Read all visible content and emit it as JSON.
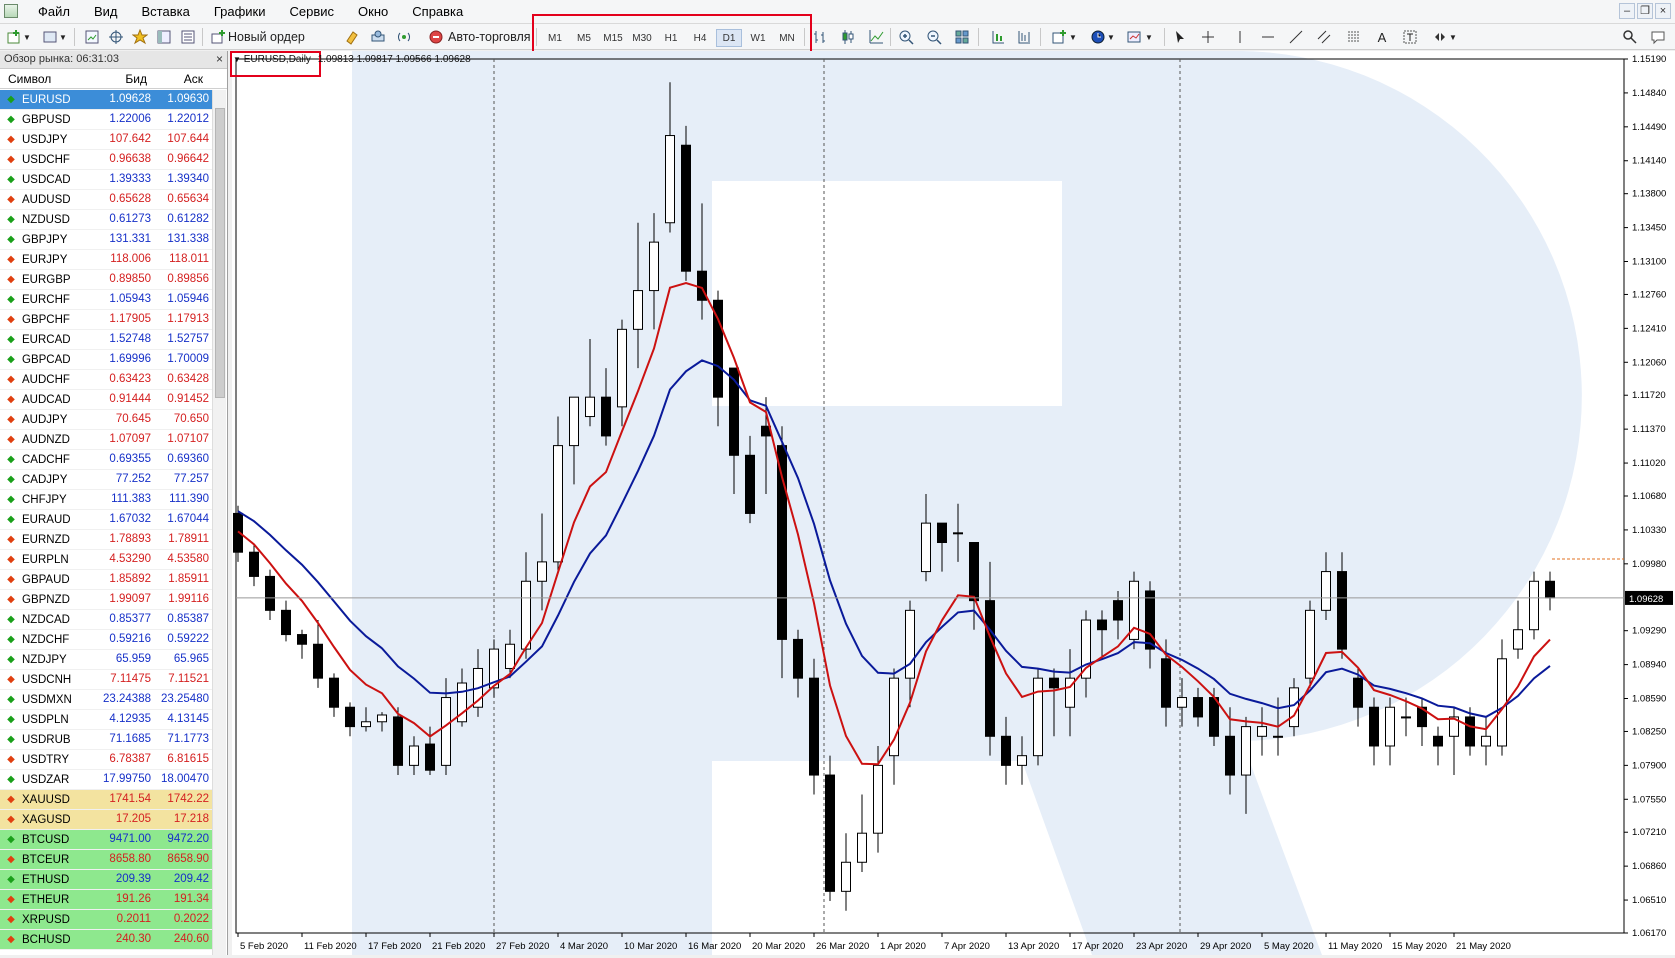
{
  "menu": [
    "Файл",
    "Вид",
    "Вставка",
    "Графики",
    "Сервис",
    "Окно",
    "Справка"
  ],
  "toolbar": {
    "new_order": "Новый ордер",
    "autotrading": "Авто-торговля"
  },
  "timeframes": [
    "M1",
    "M5",
    "M15",
    "M30",
    "H1",
    "H4",
    "D1",
    "W1",
    "MN"
  ],
  "active_timeframe": "D1",
  "sidebar": {
    "title": "Обзор рынка: 06:31:03",
    "col_symbol": "Символ",
    "col_bid": "Бид",
    "col_ask": "Аск"
  },
  "quotes": [
    {
      "s": "EURUSD",
      "b": "1.09628",
      "a": "1.09630",
      "d": "up"
    },
    {
      "s": "GBPUSD",
      "b": "1.22006",
      "a": "1.22012",
      "d": "up"
    },
    {
      "s": "USDJPY",
      "b": "107.642",
      "a": "107.644",
      "d": "dn"
    },
    {
      "s": "USDCHF",
      "b": "0.96638",
      "a": "0.96642",
      "d": "dn"
    },
    {
      "s": "USDCAD",
      "b": "1.39333",
      "a": "1.39340",
      "d": "up"
    },
    {
      "s": "AUDUSD",
      "b": "0.65628",
      "a": "0.65634",
      "d": "dn"
    },
    {
      "s": "NZDUSD",
      "b": "0.61273",
      "a": "0.61282",
      "d": "up"
    },
    {
      "s": "GBPJPY",
      "b": "131.331",
      "a": "131.338",
      "d": "up"
    },
    {
      "s": "EURJPY",
      "b": "118.006",
      "a": "118.011",
      "d": "dn"
    },
    {
      "s": "EURGBP",
      "b": "0.89850",
      "a": "0.89856",
      "d": "dn"
    },
    {
      "s": "EURCHF",
      "b": "1.05943",
      "a": "1.05946",
      "d": "up"
    },
    {
      "s": "GBPCHF",
      "b": "1.17905",
      "a": "1.17913",
      "d": "dn"
    },
    {
      "s": "EURCAD",
      "b": "1.52748",
      "a": "1.52757",
      "d": "up"
    },
    {
      "s": "GBPCAD",
      "b": "1.69996",
      "a": "1.70009",
      "d": "up"
    },
    {
      "s": "AUDCHF",
      "b": "0.63423",
      "a": "0.63428",
      "d": "dn"
    },
    {
      "s": "AUDCAD",
      "b": "0.91444",
      "a": "0.91452",
      "d": "dn"
    },
    {
      "s": "AUDJPY",
      "b": "70.645",
      "a": "70.650",
      "d": "dn"
    },
    {
      "s": "AUDNZD",
      "b": "1.07097",
      "a": "1.07107",
      "d": "dn"
    },
    {
      "s": "CADCHF",
      "b": "0.69355",
      "a": "0.69360",
      "d": "up"
    },
    {
      "s": "CADJPY",
      "b": "77.252",
      "a": "77.257",
      "d": "up"
    },
    {
      "s": "CHFJPY",
      "b": "111.383",
      "a": "111.390",
      "d": "up"
    },
    {
      "s": "EURAUD",
      "b": "1.67032",
      "a": "1.67044",
      "d": "up"
    },
    {
      "s": "EURNZD",
      "b": "1.78893",
      "a": "1.78911",
      "d": "dn"
    },
    {
      "s": "EURPLN",
      "b": "4.53290",
      "a": "4.53580",
      "d": "dn"
    },
    {
      "s": "GBPAUD",
      "b": "1.85892",
      "a": "1.85911",
      "d": "dn"
    },
    {
      "s": "GBPNZD",
      "b": "1.99097",
      "a": "1.99116",
      "d": "dn"
    },
    {
      "s": "NZDCAD",
      "b": "0.85377",
      "a": "0.85387",
      "d": "up"
    },
    {
      "s": "NZDCHF",
      "b": "0.59216",
      "a": "0.59222",
      "d": "up"
    },
    {
      "s": "NZDJPY",
      "b": "65.959",
      "a": "65.965",
      "d": "up"
    },
    {
      "s": "USDCNH",
      "b": "7.11475",
      "a": "7.11521",
      "d": "dn"
    },
    {
      "s": "USDMXN",
      "b": "23.24388",
      "a": "23.25480",
      "d": "up"
    },
    {
      "s": "USDPLN",
      "b": "4.12935",
      "a": "4.13145",
      "d": "up"
    },
    {
      "s": "USDRUB",
      "b": "71.1685",
      "a": "71.1773",
      "d": "up"
    },
    {
      "s": "USDTRY",
      "b": "6.78387",
      "a": "6.81615",
      "d": "dn"
    },
    {
      "s": "USDZAR",
      "b": "17.99750",
      "a": "18.00470",
      "d": "up"
    },
    {
      "s": "XAUUSD",
      "b": "1741.54",
      "a": "1742.22",
      "d": "dn",
      "k": "metal"
    },
    {
      "s": "XAGUSD",
      "b": "17.205",
      "a": "17.218",
      "d": "dn",
      "k": "metal"
    },
    {
      "s": "BTCUSD",
      "b": "9471.00",
      "a": "9472.20",
      "d": "up",
      "k": "crypto"
    },
    {
      "s": "BTCEUR",
      "b": "8658.80",
      "a": "8658.90",
      "d": "dn",
      "k": "crypto"
    },
    {
      "s": "ETHUSD",
      "b": "209.39",
      "a": "209.42",
      "d": "up",
      "k": "crypto"
    },
    {
      "s": "ETHEUR",
      "b": "191.26",
      "a": "191.34",
      "d": "dn",
      "k": "crypto"
    },
    {
      "s": "XRPUSD",
      "b": "0.2011",
      "a": "0.2022",
      "d": "dn",
      "k": "crypto"
    },
    {
      "s": "BCHUSD",
      "b": "240.30",
      "a": "240.60",
      "d": "dn",
      "k": "crypto"
    }
  ],
  "chart": {
    "symbol": "EURUSD,Daily",
    "ohlc_label": "1.09813 1.09817 1.09566 1.09628",
    "current_price": "1.09628",
    "price_ticks": [
      "1.15190",
      "1.14840",
      "1.14490",
      "1.14140",
      "1.13800",
      "1.13450",
      "1.13100",
      "1.12760",
      "1.12410",
      "1.12060",
      "1.11720",
      "1.11370",
      "1.11020",
      "1.10680",
      "1.10330",
      "1.09980",
      "1.09290",
      "1.08940",
      "1.08590",
      "1.08250",
      "1.07900",
      "1.07550",
      "1.07210",
      "1.06860",
      "1.06510",
      "1.06170"
    ],
    "date_ticks": [
      "5 Feb 2020",
      "11 Feb 2020",
      "17 Feb 2020",
      "21 Feb 2020",
      "27 Feb 2020",
      "4 Mar 2020",
      "10 Mar 2020",
      "16 Mar 2020",
      "20 Mar 2020",
      "26 Mar 2020",
      "1 Apr 2020",
      "7 Apr 2020",
      "13 Apr 2020",
      "17 Apr 2020",
      "23 Apr 2020",
      "29 Apr 2020",
      "5 May 2020",
      "11 May 2020",
      "15 May 2020",
      "21 May 2020"
    ],
    "colors": {
      "bull": "#ffffff",
      "bear": "#000000",
      "ma_fast": "#cc1111",
      "ma_slow": "#0a1a9a",
      "watermark": "#e6eef8",
      "highlight": "#e3001b"
    }
  },
  "chart_data": {
    "type": "candlestick",
    "title": "EURUSD,Daily",
    "ylim": [
      1.0617,
      1.1519
    ],
    "ohlc": [
      [
        1.105,
        1.1058,
        1.1,
        1.101
      ],
      [
        1.101,
        1.1018,
        1.0975,
        1.0985
      ],
      [
        1.0985,
        1.0992,
        1.094,
        1.095
      ],
      [
        1.095,
        1.096,
        1.0918,
        1.0925
      ],
      [
        1.0925,
        1.093,
        1.09,
        1.0915
      ],
      [
        1.0915,
        1.094,
        1.087,
        1.088
      ],
      [
        1.088,
        1.0885,
        1.084,
        1.085
      ],
      [
        1.085,
        1.0855,
        1.082,
        1.083
      ],
      [
        1.083,
        1.085,
        1.0825,
        1.0835
      ],
      [
        1.0835,
        1.0845,
        1.0825,
        1.0842
      ],
      [
        1.084,
        1.085,
        1.078,
        1.079
      ],
      [
        1.079,
        1.082,
        1.078,
        1.081
      ],
      [
        1.0812,
        1.083,
        1.078,
        1.0785
      ],
      [
        1.079,
        1.088,
        1.078,
        1.086
      ],
      [
        1.0835,
        1.089,
        1.083,
        1.0875
      ],
      [
        1.085,
        1.091,
        1.084,
        1.089
      ],
      [
        1.087,
        1.092,
        1.086,
        1.091
      ],
      [
        1.089,
        1.093,
        1.088,
        1.0915
      ],
      [
        1.091,
        1.101,
        1.09,
        1.098
      ],
      [
        1.098,
        1.105,
        1.095,
        1.1
      ],
      [
        1.1,
        1.115,
        1.099,
        1.112
      ],
      [
        1.112,
        1.117,
        1.108,
        1.117
      ],
      [
        1.115,
        1.123,
        1.114,
        1.117
      ],
      [
        1.117,
        1.12,
        1.112,
        1.113
      ],
      [
        1.116,
        1.125,
        1.114,
        1.124
      ],
      [
        1.124,
        1.135,
        1.12,
        1.128
      ],
      [
        1.128,
        1.136,
        1.124,
        1.133
      ],
      [
        1.135,
        1.1495,
        1.134,
        1.144
      ],
      [
        1.143,
        1.145,
        1.129,
        1.13
      ],
      [
        1.13,
        1.137,
        1.125,
        1.127
      ],
      [
        1.127,
        1.128,
        1.114,
        1.117
      ],
      [
        1.12,
        1.12,
        1.107,
        1.111
      ],
      [
        1.111,
        1.113,
        1.104,
        1.105
      ],
      [
        1.114,
        1.117,
        1.107,
        1.113
      ],
      [
        1.112,
        1.114,
        1.088,
        1.092
      ],
      [
        1.092,
        1.093,
        1.086,
        1.088
      ],
      [
        1.088,
        1.09,
        1.076,
        1.078
      ],
      [
        1.078,
        1.08,
        1.065,
        1.066
      ],
      [
        1.066,
        1.072,
        1.064,
        1.069
      ],
      [
        1.069,
        1.076,
        1.068,
        1.072
      ],
      [
        1.072,
        1.081,
        1.07,
        1.079
      ],
      [
        1.08,
        1.089,
        1.077,
        1.088
      ],
      [
        1.088,
        1.096,
        1.085,
        1.095
      ],
      [
        1.099,
        1.107,
        1.098,
        1.104
      ],
      [
        1.104,
        1.104,
        1.099,
        1.102
      ],
      [
        1.103,
        1.106,
        1.1,
        1.103
      ],
      [
        1.102,
        1.102,
        1.093,
        1.096
      ],
      [
        1.096,
        1.1,
        1.08,
        1.082
      ],
      [
        1.082,
        1.084,
        1.077,
        1.079
      ],
      [
        1.079,
        1.082,
        1.077,
        1.08
      ],
      [
        1.08,
        1.089,
        1.079,
        1.088
      ],
      [
        1.088,
        1.089,
        1.082,
        1.087
      ],
      [
        1.085,
        1.091,
        1.082,
        1.088
      ],
      [
        1.088,
        1.095,
        1.086,
        1.094
      ],
      [
        1.094,
        1.095,
        1.09,
        1.093
      ],
      [
        1.096,
        1.097,
        1.092,
        1.094
      ],
      [
        1.092,
        1.099,
        1.091,
        1.098
      ],
      [
        1.097,
        1.098,
        1.089,
        1.091
      ],
      [
        1.09,
        1.092,
        1.083,
        1.085
      ],
      [
        1.085,
        1.088,
        1.083,
        1.086
      ],
      [
        1.086,
        1.087,
        1.083,
        1.084
      ],
      [
        1.086,
        1.087,
        1.081,
        1.082
      ],
      [
        1.082,
        1.085,
        1.076,
        1.078
      ],
      [
        1.078,
        1.084,
        1.074,
        1.083
      ],
      [
        1.082,
        1.085,
        1.08,
        1.083
      ],
      [
        1.082,
        1.086,
        1.08,
        1.082
      ],
      [
        1.083,
        1.088,
        1.082,
        1.087
      ],
      [
        1.088,
        1.096,
        1.087,
        1.095
      ],
      [
        1.095,
        1.101,
        1.094,
        1.099
      ],
      [
        1.099,
        1.101,
        1.09,
        1.091
      ],
      [
        1.088,
        1.089,
        1.083,
        1.085
      ],
      [
        1.085,
        1.086,
        1.079,
        1.081
      ],
      [
        1.081,
        1.086,
        1.079,
        1.085
      ],
      [
        1.084,
        1.086,
        1.082,
        1.084
      ],
      [
        1.085,
        1.086,
        1.081,
        1.083
      ],
      [
        1.082,
        1.083,
        1.079,
        1.081
      ],
      [
        1.082,
        1.085,
        1.078,
        1.084
      ],
      [
        1.084,
        1.085,
        1.08,
        1.081
      ],
      [
        1.081,
        1.084,
        1.079,
        1.082
      ],
      [
        1.081,
        1.092,
        1.08,
        1.09
      ],
      [
        1.091,
        1.096,
        1.09,
        1.093
      ],
      [
        1.093,
        1.099,
        1.092,
        1.098
      ],
      [
        1.098,
        1.099,
        1.095,
        1.0963
      ]
    ]
  }
}
